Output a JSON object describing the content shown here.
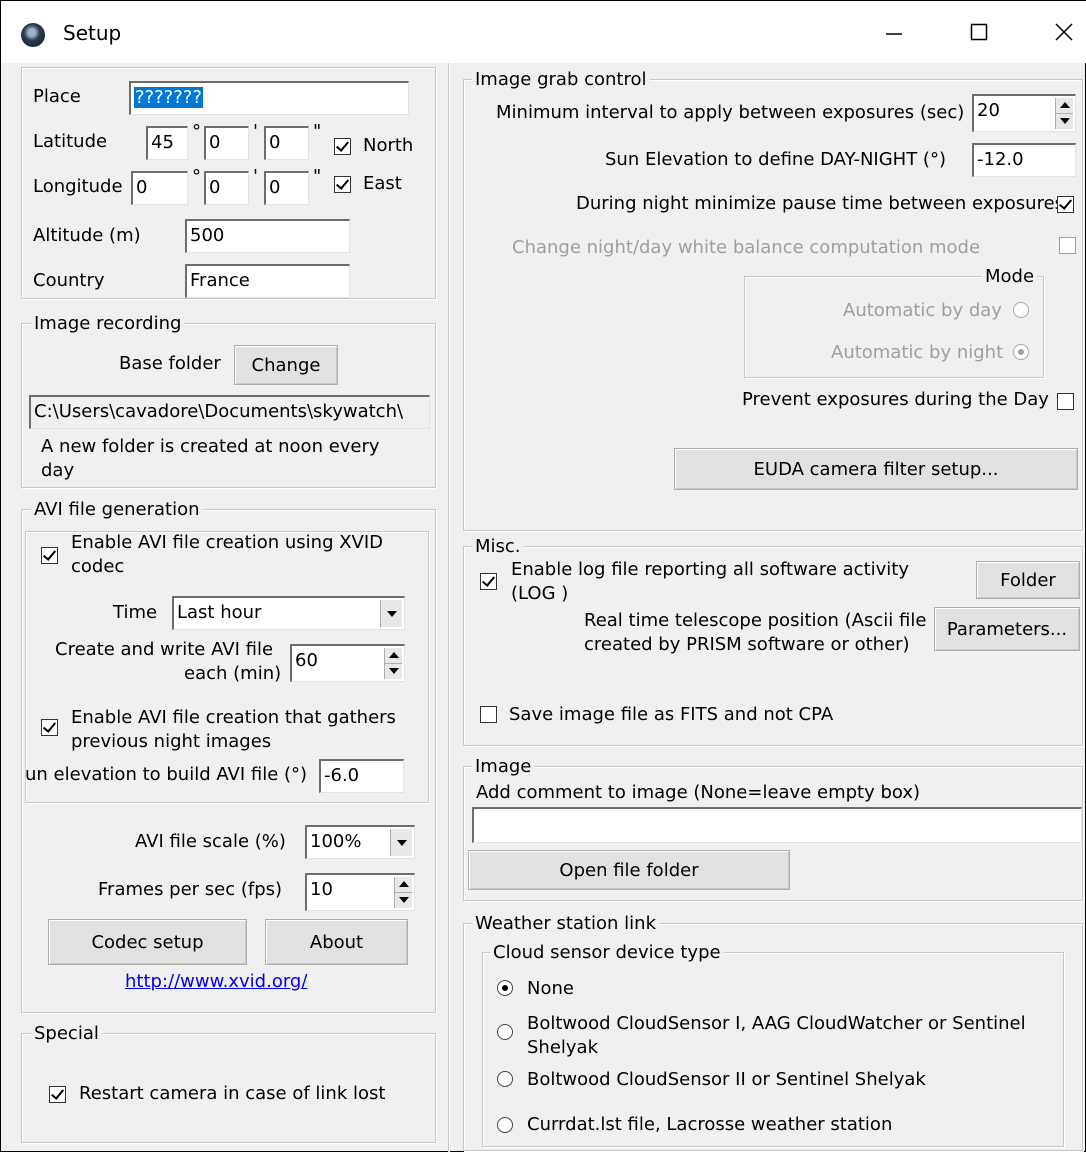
{
  "window": {
    "title": "Setup"
  },
  "location": {
    "place_label": "Place",
    "place_value": "???????",
    "latitude_label": "Latitude",
    "lat_deg": "45",
    "lat_min": "0",
    "lat_sec": "0",
    "deg_sym": "°",
    "min_sym": "'",
    "sec_sym": "\"",
    "north_label": "North",
    "longitude_label": "Longitude",
    "lon_deg": "0",
    "lon_min": "0",
    "lon_sec": "0",
    "east_label": "East",
    "altitude_label": "Altitude (m)",
    "altitude_value": "500",
    "country_label": "Country",
    "country_value": "France"
  },
  "image_recording": {
    "title": "Image recording",
    "base_folder_label": "Base folder",
    "change_button": "Change",
    "path": "C:\\Users\\cavadore\\Documents\\skywatch\\",
    "note_line1": "A new folder is created at noon every",
    "note_line2": "day"
  },
  "avi": {
    "title": "AVI file generation",
    "enable_xvid_line1": "Enable AVI file creation using XVID",
    "enable_xvid_line2": "codec",
    "time_label": "Time",
    "time_value": "Last hour",
    "each_line1": "Create and write AVI file",
    "each_line2": "each (min)",
    "each_value": "60",
    "gather_line1": "Enable AVI file creation that gathers",
    "gather_line2": "previous night images",
    "sun_elev_label": "un elevation to build AVI file (°)",
    "sun_elev_value": "-6.0",
    "scale_label": "AVI file scale (%)",
    "scale_value": "100%",
    "fps_label": "Frames per sec  (fps)",
    "fps_value": "10",
    "codec_button": "Codec setup",
    "about_button": "About",
    "link": "http://www.xvid.org/"
  },
  "special": {
    "title": "Special",
    "restart_label": "Restart camera in case of link lost"
  },
  "grab": {
    "title": "Image grab control",
    "min_interval_label": "Minimum interval to apply between exposures (sec)",
    "min_interval_value": "20",
    "sun_elev_label": "Sun Elevation to define DAY-NIGHT  (°)",
    "sun_elev_value": "-12.0",
    "night_min_label": "During night minimize pause time between exposures",
    "wb_label": "Change night/day white balance computation mode",
    "mode_title": "Mode",
    "mode_day": "Automatic by day",
    "mode_night": "Automatic by night",
    "prevent_label": "Prevent exposures during the Day",
    "euda_button": "EUDA camera filter setup..."
  },
  "misc": {
    "title": "Misc.",
    "log_line1": "Enable log file reporting all software activity",
    "log_line2": "(LOG )",
    "folder_button": "Folder",
    "tel_line1": "Real time telescope position (Ascii file",
    "tel_line2": "created by PRISM software or other)",
    "params_button": "Parameters...",
    "fits_label": "Save image file as FITS and not CPA"
  },
  "image": {
    "title": "Image",
    "comment_label": "Add comment to image (None=leave empty box)",
    "comment_value": "",
    "open_button": "Open file folder"
  },
  "weather": {
    "title": "Weather station link",
    "cloud_title": "Cloud sensor device type",
    "opt_none": "None",
    "opt_b1_line1": "Boltwood CloudSensor I, AAG CloudWatcher or Sentinel",
    "opt_b1_line2": "Shelyak",
    "opt_b2": "Boltwood CloudSensor II or Sentinel Shelyak",
    "opt_currdat": "Currdat.lst file, Lacrosse weather station"
  }
}
